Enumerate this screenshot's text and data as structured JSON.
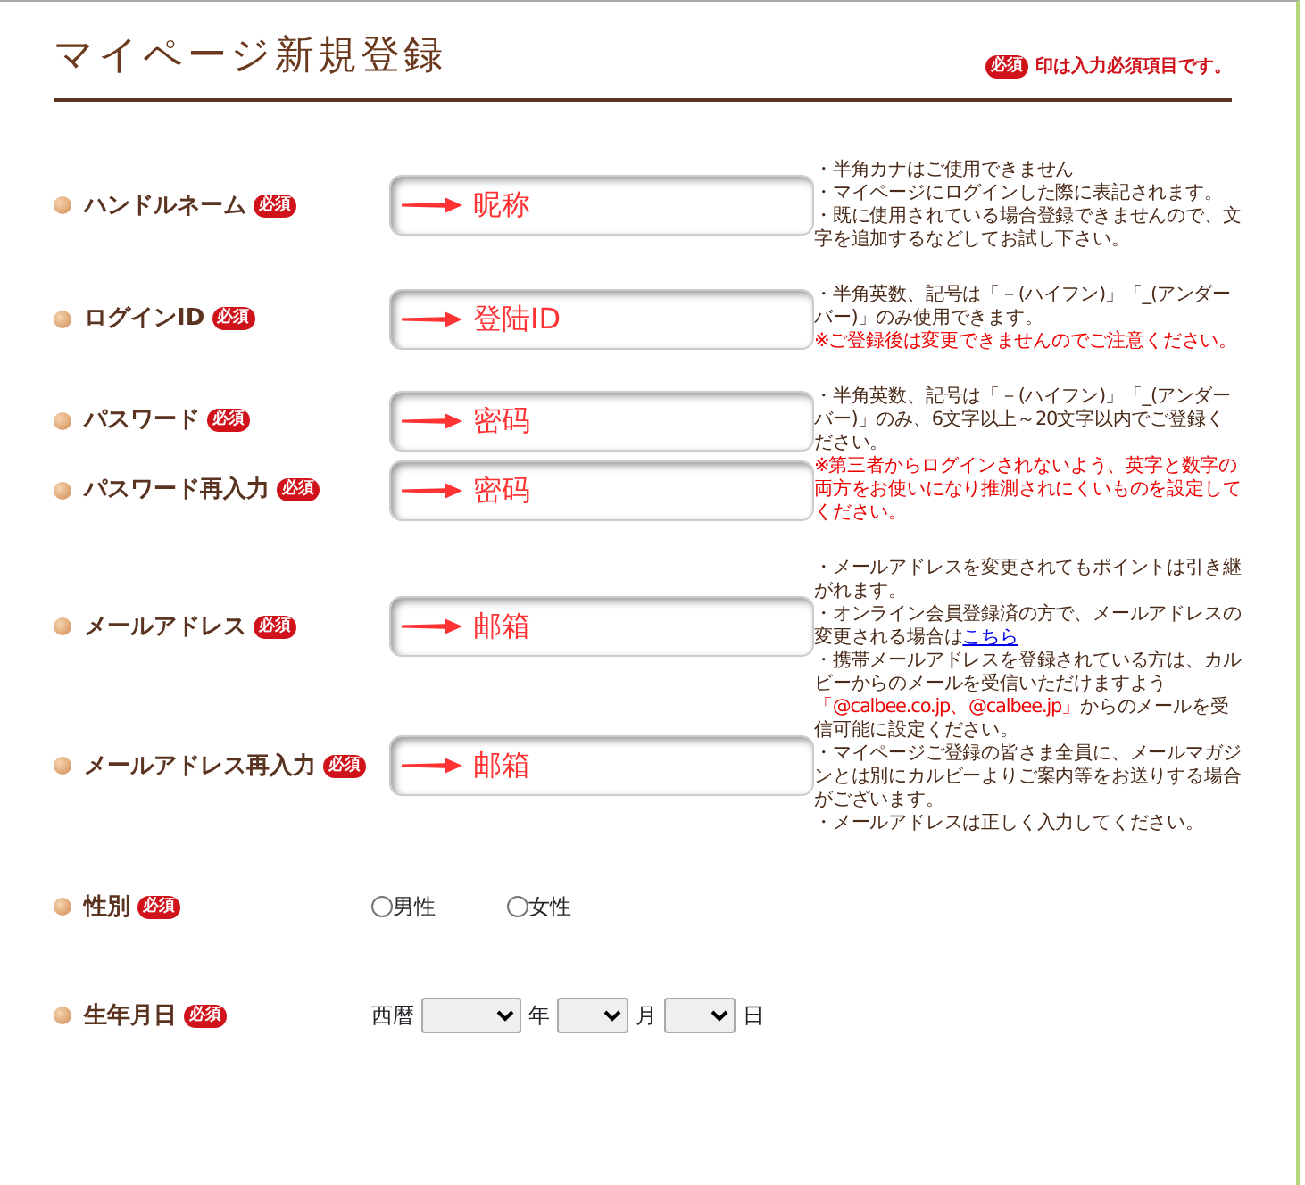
{
  "header": {
    "title": "マイページ新規登録",
    "required_badge": "必須",
    "required_note": "印は入力必須項目です。"
  },
  "sections": [
    {
      "fields": [
        {
          "label": "ハンドルネーム",
          "badge": "必須",
          "value": "昵称"
        }
      ],
      "notes": [
        [
          {
            "kind": "plain",
            "text": "・半角カナはご使用できません"
          }
        ],
        [
          {
            "kind": "plain",
            "text": "・マイページにログインした際に表記されます。"
          }
        ],
        [
          {
            "kind": "plain",
            "text": "・既に使用されている場合登録できませんので、文字を追加するなどしてお試し下さい。"
          }
        ]
      ]
    },
    {
      "fields": [
        {
          "label": "ログインID",
          "badge": "必須",
          "value": "登陆ID"
        }
      ],
      "notes": [
        [
          {
            "kind": "plain",
            "text": "・半角英数、記号は「－(ハイフン)」「_(アンダーバー)」のみ使用できます。"
          }
        ],
        [
          {
            "kind": "warning",
            "text": "※ご登録後は変更できませんのでご注意ください。"
          }
        ]
      ]
    },
    {
      "fields": [
        {
          "label": "パスワード",
          "badge": "必須",
          "value": "密码"
        },
        {
          "label": "パスワード再入力",
          "badge": "必須",
          "value": "密码"
        }
      ],
      "notes": [
        [
          {
            "kind": "plain",
            "text": "・半角英数、記号は「－(ハイフン)」「_(アンダーバー)」のみ、6文字以上～20文字以内でご登録ください。"
          }
        ],
        [
          {
            "kind": "warning",
            "text": "※第三者からログインされないよう、英字と数字の両方をお使いになり推測されにくいものを設定してください。"
          }
        ]
      ]
    },
    {
      "fields": [
        {
          "label": "メールアドレス",
          "badge": "必須",
          "value": "邮箱"
        },
        {
          "label": "メールアドレス再入力",
          "badge": "必須",
          "value": "邮箱"
        }
      ],
      "notes": [
        [
          {
            "kind": "plain",
            "text": "・メールアドレスを変更されてもポイントは引き継がれます。"
          }
        ],
        [
          {
            "kind": "plain",
            "text": "・オンライン会員登録済の方で、メールアドレスの変更される場合は"
          },
          {
            "kind": "link",
            "text": "こちら"
          }
        ],
        [
          {
            "kind": "plain",
            "text": "・携帯メールアドレスを登録されている方は、カルビーからのメールを受信いただけますよう"
          },
          {
            "kind": "warning",
            "text": "「@calbee.co.jp、@calbee.jp」"
          },
          {
            "kind": "plain",
            "text": "からのメールを受信可能に設定ください。"
          }
        ],
        [
          {
            "kind": "plain",
            "text": "・マイページご登録の皆さま全員に、メールマガジンとは別にカルビーよりご案内等をお送りする場合がございます。"
          }
        ],
        [
          {
            "kind": "plain",
            "text": "・メールアドレスは正しく入力してください。"
          }
        ]
      ]
    }
  ],
  "gender": {
    "label": "性別",
    "badge": "必須",
    "options": [
      {
        "label": "男性",
        "selected": false
      },
      {
        "label": "女性",
        "selected": false
      }
    ]
  },
  "birthday": {
    "label": "生年月日",
    "badge": "必須",
    "parts": [
      "西暦",
      "年",
      "月",
      "日"
    ]
  }
}
